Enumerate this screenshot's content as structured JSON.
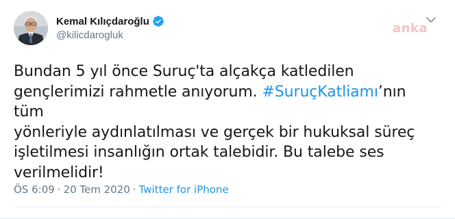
{
  "tweet": {
    "author": {
      "display_name": "Kemal Kılıçdaroğlu",
      "username": "@kilicdarogluk",
      "verified_icon": "verified-badge-icon",
      "avatar_icon": "avatar-portrait"
    },
    "watermark": "anka",
    "text_parts": {
      "part1": "Bundan 5 yıl önce Suruç'ta alçakça katledilen",
      "part2": "gençlerimizi rahmetle anıyorum. ",
      "hashtag": "#SuruçKatliamı",
      "part3": "’nın tüm",
      "part4": "yönleriyle aydınlatılması ve gerçek bir hukuksal süreç",
      "part5": "işletilmesi insanlığın ortak talebidir. Bu talebe ses",
      "part6": "verilmelidir!"
    },
    "time": "ÖS 6:09",
    "separator": "·",
    "date": "20 Tem 2020",
    "source": "Twitter for iPhone",
    "menu_icon": "chevron-down-icon"
  },
  "colors": {
    "link": "#1b95e0",
    "muted": "#657786",
    "text": "#14171a",
    "verified": "#1da1f2"
  }
}
